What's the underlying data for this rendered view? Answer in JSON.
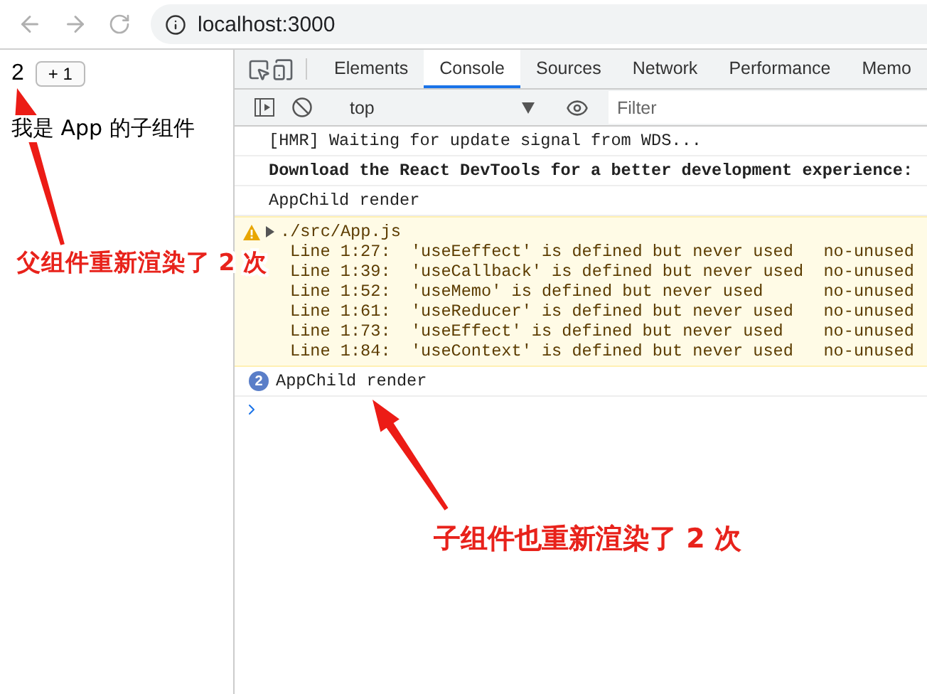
{
  "browser": {
    "address": "localhost:3000"
  },
  "page": {
    "count": "2",
    "button": "+ 1",
    "child_text": "我是 App 的子组件"
  },
  "devtools": {
    "tabs": [
      {
        "label": "Elements",
        "selected": false
      },
      {
        "label": "Console",
        "selected": true
      },
      {
        "label": "Sources",
        "selected": false
      },
      {
        "label": "Network",
        "selected": false
      },
      {
        "label": "Performance",
        "selected": false
      },
      {
        "label": "Memo",
        "selected": false
      }
    ],
    "context": "top",
    "filter_placeholder": "Filter",
    "messages": [
      {
        "kind": "log",
        "text": "[HMR] Waiting for update signal from WDS..."
      },
      {
        "kind": "bold",
        "text": "Download the React DevTools for a better development experience:"
      },
      {
        "kind": "log",
        "text": "AppChild render"
      },
      {
        "kind": "warning",
        "text": "./src/App.js",
        "lines": [
          "Line 1:27:  'useEeffect' is defined but never used   no-unused",
          "Line 1:39:  'useCallback' is defined but never used  no-unused",
          "Line 1:52:  'useMemo' is defined but never used      no-unused",
          "Line 1:61:  'useReducer' is defined but never used   no-unused",
          "Line 1:73:  'useEffect' is defined but never used    no-unused",
          "Line 1:84:  'useContext' is defined but never used   no-unused"
        ]
      },
      {
        "kind": "repeat",
        "count": "2",
        "text": "AppChild render"
      }
    ]
  },
  "annotations": [
    {
      "text": "父组件重新渲染了 2 次"
    },
    {
      "text": "子组件也重新渲染了 2 次"
    }
  ]
}
